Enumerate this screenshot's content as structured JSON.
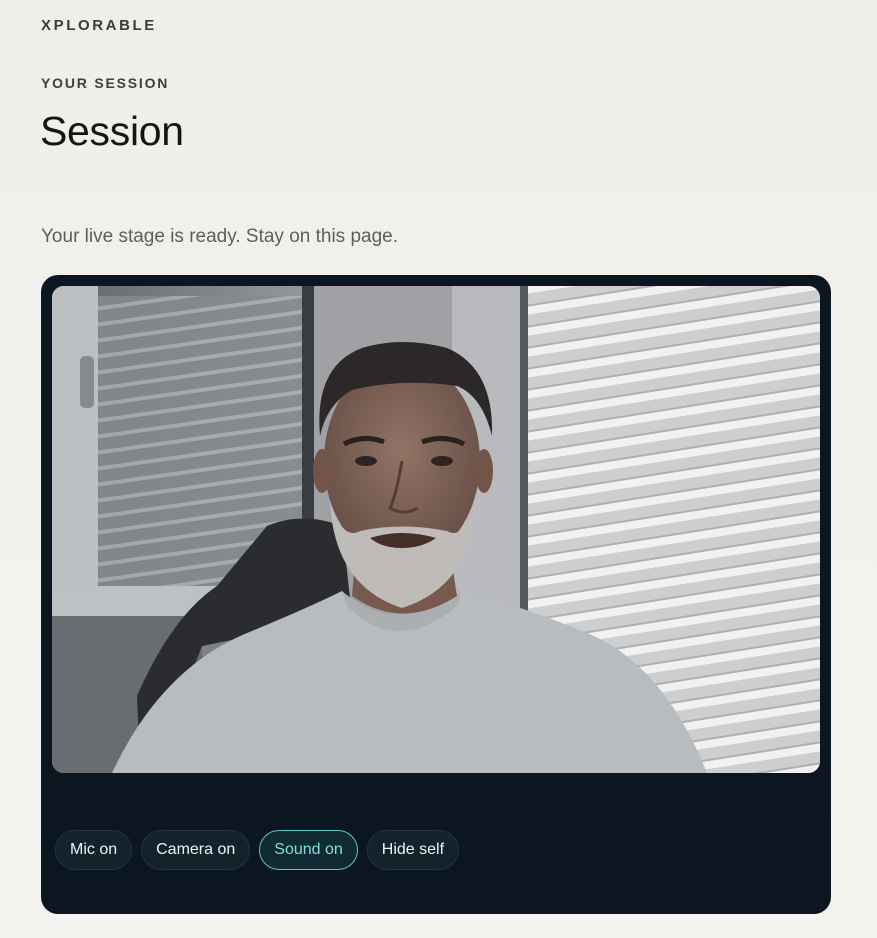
{
  "brand": "XPLORABLE",
  "eyebrow": "YOUR SESSION",
  "title": "Session",
  "description": "Your live stage is ready. Stay on this page.",
  "controls": {
    "mic": "Mic on",
    "camera": "Camera on",
    "sound": "Sound on",
    "hide_self": "Hide self"
  },
  "colors": {
    "stage_bg": "#0b1620",
    "accent": "#5cc7c6"
  }
}
